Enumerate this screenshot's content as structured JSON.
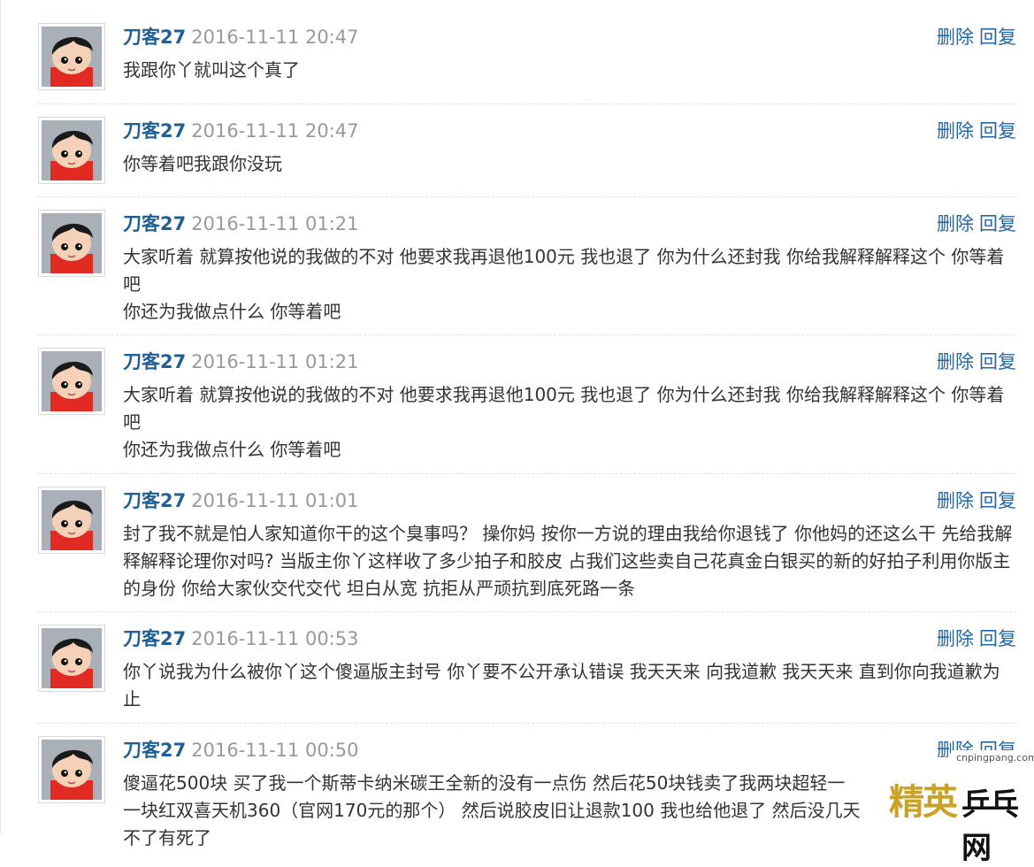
{
  "actions": {
    "delete_label": "删除",
    "reply_label": "回复"
  },
  "posts": [
    {
      "author": "刀客27",
      "time": "2016-11-11 20:47",
      "lines": [
        "我跟你丫就叫这个真了"
      ]
    },
    {
      "author": "刀客27",
      "time": "2016-11-11 20:47",
      "lines": [
        "你等着吧我跟你没玩"
      ]
    },
    {
      "author": "刀客27",
      "time": "2016-11-11 01:21",
      "lines": [
        "大家听着 就算按他说的我做的不对 他要求我再退他100元 我也退了 你为什么还封我 你给我解释解释这个 你等着吧",
        "你还为我做点什么 你等着吧"
      ]
    },
    {
      "author": "刀客27",
      "time": "2016-11-11 01:21",
      "lines": [
        "大家听着 就算按他说的我做的不对 他要求我再退他100元 我也退了 你为什么还封我 你给我解释解释这个 你等着吧",
        "你还为我做点什么 你等着吧"
      ]
    },
    {
      "author": "刀客27",
      "time": "2016-11-11 01:01",
      "lines": [
        "封了我不就是怕人家知道你干的这个臭事吗？ 操你妈 按你一方说的理由我给你退钱了 你他妈的还这么干 先给我解释解释论理你对吗? 当版主你丫这样收了多少拍子和胶皮 占我们这些卖自己花真金白银买的新的好拍子利用你版主的身份 你给大家伙交代交代 坦白从宽 抗拒从严顽抗到底死路一条"
      ]
    },
    {
      "author": "刀客27",
      "time": "2016-11-11 00:53",
      "lines": [
        "你丫说我为什么被你丫这个傻逼版主封号 你丫要不公开承认错误 我天天来 向我道歉 我天天来 直到你向我道歉为止"
      ]
    },
    {
      "author": "刀客27",
      "time": "2016-11-11 00:50",
      "lines": [
        "傻逼花500块 买了我一个斯蒂卡纳米碳王全新的没有一点伤 然后花50块钱卖了我两块超轻一",
        "一块红双喜天机360（官网170元的那个） 然后说胶皮旧让退款100 我也给他退了 然后没几天",
        "不了有死了"
      ]
    }
  ],
  "watermark": {
    "url": "cnpingpang.com",
    "brand_left": "精英",
    "brand_right": "乒乓网"
  }
}
